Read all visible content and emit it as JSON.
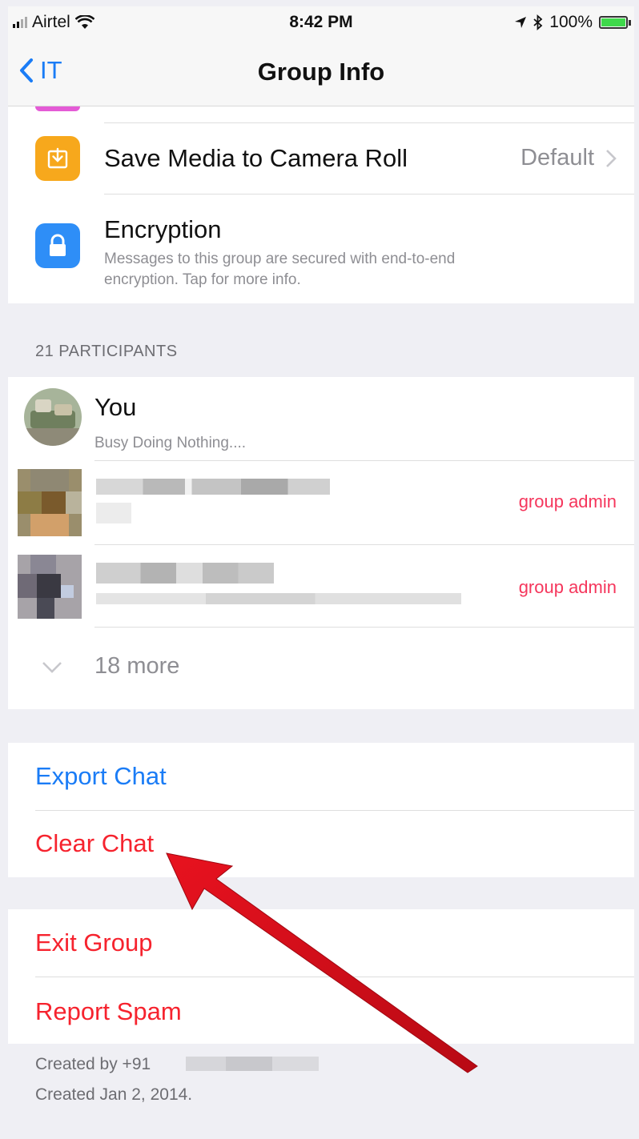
{
  "status_bar": {
    "carrier": "Airtel",
    "time": "8:42 PM",
    "battery": "100%"
  },
  "nav": {
    "back_label": "IT",
    "title": "Group Info"
  },
  "settings": {
    "save_media": {
      "label": "Save Media to Camera Roll",
      "value": "Default",
      "icon": "download-icon"
    },
    "encryption": {
      "label": "Encryption",
      "sub_line1": "Messages to this group are secured with end-to-end",
      "sub_line2": "encryption. Tap for more info.",
      "icon": "lock-icon"
    }
  },
  "participants": {
    "header": "21 PARTICIPANTS",
    "you": {
      "name": "You",
      "status": "Busy Doing Nothing...."
    },
    "admin_badge": "group admin",
    "more_label": "18 more"
  },
  "actions": {
    "export": "Export Chat",
    "clear": "Clear Chat",
    "exit": "Exit Group",
    "report": "Report Spam"
  },
  "footer": {
    "created_by": "Created by +91",
    "created_on": "Created Jan 2, 2014."
  },
  "colors": {
    "accent_blue": "#1a7cf6",
    "destructive_red": "#f6232e",
    "admin_pink": "#f5365c",
    "annotation_arrow": "#d9101c"
  }
}
